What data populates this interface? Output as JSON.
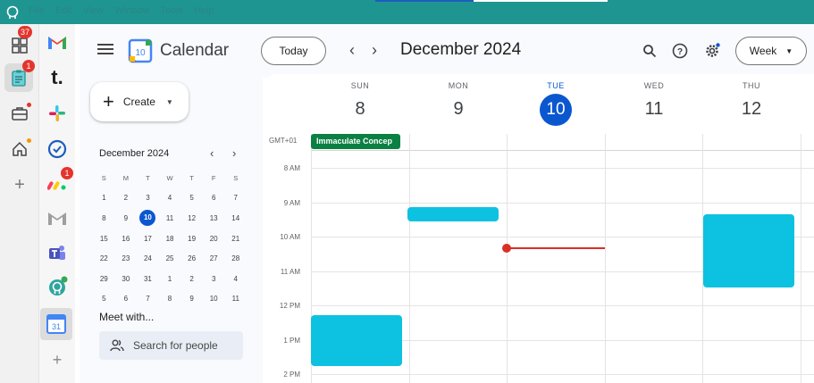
{
  "app": {
    "menu": [
      "File",
      "Edit",
      "View",
      "Window",
      "Tools",
      "Help"
    ]
  },
  "dock": {
    "badges": {
      "mail_count": "37",
      "notes_count": "1",
      "monday_count": "1"
    }
  },
  "calendar": {
    "title": "Calendar",
    "logo_day": "10",
    "today_button": "Today",
    "period": "December 2024",
    "view_button": "Week",
    "create_label": "Create",
    "mini": {
      "title": "December 2024",
      "dow": [
        "S",
        "M",
        "T",
        "W",
        "T",
        "F",
        "S"
      ],
      "weeks": [
        [
          "1",
          "2",
          "3",
          "4",
          "5",
          "6",
          "7"
        ],
        [
          "8",
          "9",
          "10",
          "11",
          "12",
          "13",
          "14"
        ],
        [
          "15",
          "16",
          "17",
          "18",
          "19",
          "20",
          "21"
        ],
        [
          "22",
          "23",
          "24",
          "25",
          "26",
          "27",
          "28"
        ],
        [
          "29",
          "30",
          "31",
          "1",
          "2",
          "3",
          "4"
        ],
        [
          "5",
          "6",
          "7",
          "8",
          "9",
          "10",
          "11"
        ]
      ],
      "today": "10"
    },
    "meet_with": "Meet with...",
    "search_people": "Search for people",
    "timezone": "GMT+01",
    "days": [
      {
        "dow": "SUN",
        "num": "8"
      },
      {
        "dow": "MON",
        "num": "9"
      },
      {
        "dow": "TUE",
        "num": "10"
      },
      {
        "dow": "WED",
        "num": "11"
      },
      {
        "dow": "THU",
        "num": "12"
      }
    ],
    "hours": [
      "8 AM",
      "9 AM",
      "10 AM",
      "11 AM",
      "12 PM",
      "1 PM",
      "2 PM"
    ],
    "allday_event": "Immaculate Concep",
    "colors": {
      "accent": "#0b57d0",
      "event": "#0dc2e0",
      "allday": "#0b8043",
      "now": "#d93025",
      "titlebar": "#1f9591"
    }
  }
}
